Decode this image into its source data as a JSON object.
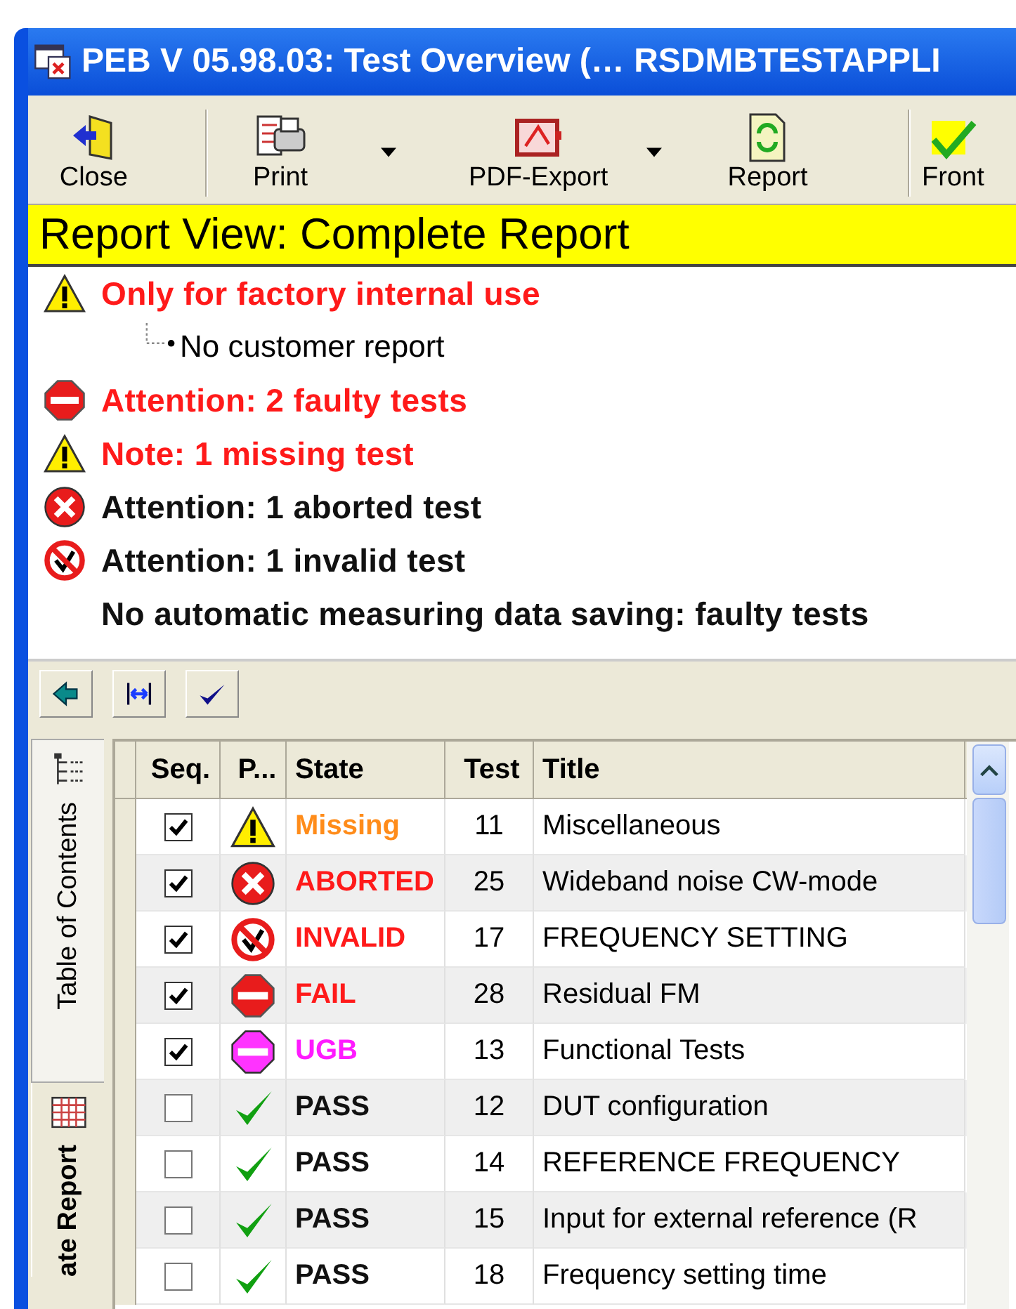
{
  "window": {
    "title": "PEB  V 05.98.03: Test Overview (… RSDMBTESTAPPLI"
  },
  "toolbar": [
    {
      "label": "Close",
      "kind": "close",
      "dropdown": false
    },
    {
      "label": "Print",
      "kind": "print",
      "dropdown": true
    },
    {
      "label": "PDF-Export",
      "kind": "pdf",
      "dropdown": true
    },
    {
      "label": "Report",
      "kind": "report",
      "dropdown": false
    },
    {
      "label": "Front",
      "kind": "front",
      "dropdown": false
    }
  ],
  "report_view": {
    "title": "Report View: Complete Report",
    "messages": [
      {
        "kind": "warning",
        "text": "Only for factory internal use",
        "color": "#ff1a1a",
        "children": [
          {
            "text": "No customer report"
          }
        ]
      },
      {
        "kind": "stop",
        "text": "Attention: 2 faulty tests",
        "color": "#ff1a1a"
      },
      {
        "kind": "warning",
        "text": "Note: 1 missing test",
        "color": "#ff1a1a"
      },
      {
        "kind": "aborted",
        "text": "Attention: 1 aborted test",
        "color": "#111111"
      },
      {
        "kind": "invalid",
        "text": "Attention: 1 invalid test",
        "color": "#111111"
      },
      {
        "kind": "none",
        "text": "No automatic measuring data saving: faulty tests",
        "color": "#111111"
      }
    ]
  },
  "small_toolbar": [
    {
      "kind": "back"
    },
    {
      "kind": "fit-width"
    },
    {
      "kind": "check"
    }
  ],
  "side_tabs": [
    {
      "label": "Table of Contents",
      "kind": "tree",
      "selected": false
    },
    {
      "label": "ate Report",
      "kind": "grid",
      "selected": true
    }
  ],
  "table": {
    "columns": [
      "Seq.",
      "P...",
      "State",
      "Test",
      "Title"
    ],
    "rows": [
      {
        "checked": true,
        "kind": "warning",
        "state": "Missing",
        "color": "#ff8c1a",
        "test": "11",
        "title": "Miscellaneous"
      },
      {
        "checked": true,
        "kind": "aborted",
        "state": "ABORTED",
        "color": "#ff1a1a",
        "test": "25",
        "title": "Wideband noise CW-mode"
      },
      {
        "checked": true,
        "kind": "invalid",
        "state": "INVALID",
        "color": "#ff1a1a",
        "test": "17",
        "title": "FREQUENCY SETTING"
      },
      {
        "checked": true,
        "kind": "stop",
        "state": "FAIL",
        "color": "#ff1a1a",
        "test": "28",
        "title": "Residual FM"
      },
      {
        "checked": true,
        "kind": "ugb",
        "state": "UGB",
        "color": "#ff1aff",
        "test": "13",
        "title": "Functional Tests"
      },
      {
        "checked": false,
        "kind": "check",
        "state": "PASS",
        "color": "#111111",
        "test": "12",
        "title": "DUT configuration"
      },
      {
        "checked": false,
        "kind": "check",
        "state": "PASS",
        "color": "#111111",
        "test": "14",
        "title": "REFERENCE FREQUENCY"
      },
      {
        "checked": false,
        "kind": "check",
        "state": "PASS",
        "color": "#111111",
        "test": "15",
        "title": "Input for external reference (R"
      },
      {
        "checked": false,
        "kind": "check",
        "state": "PASS",
        "color": "#111111",
        "test": "18",
        "title": "Frequency setting time"
      }
    ]
  }
}
